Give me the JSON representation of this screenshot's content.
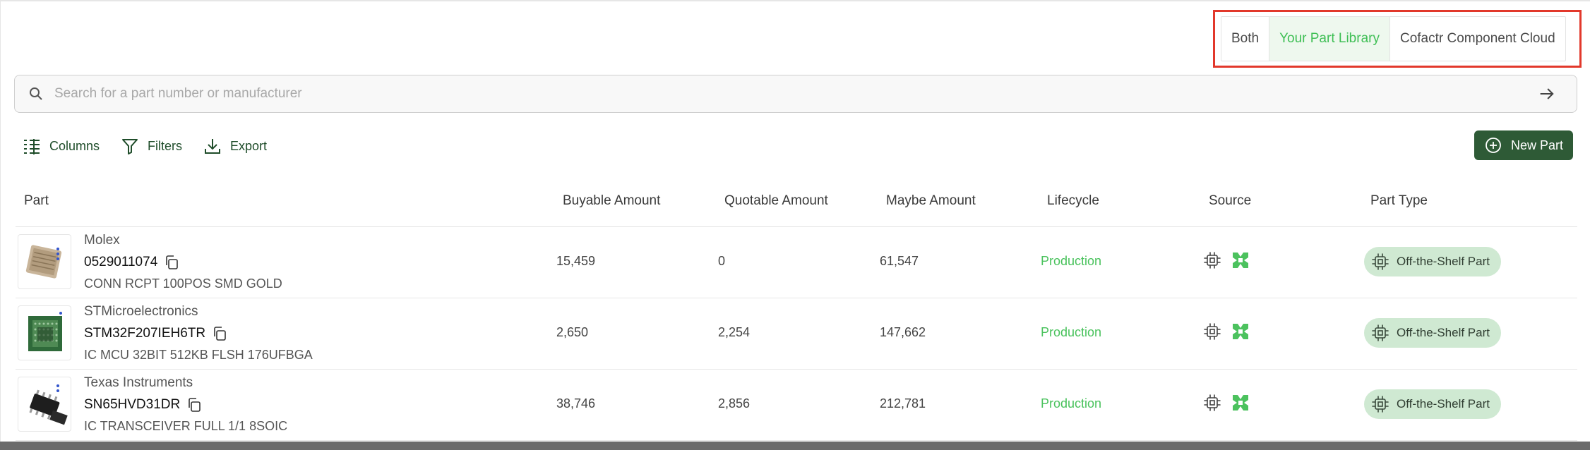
{
  "source_toggle": {
    "options": [
      {
        "label": "Both",
        "active": false
      },
      {
        "label": "Your Part Library",
        "active": true
      },
      {
        "label": "Cofactr Component Cloud",
        "active": false
      }
    ]
  },
  "search": {
    "placeholder": "Search for a part number or manufacturer",
    "value": ""
  },
  "toolbar": {
    "columns_label": "Columns",
    "filters_label": "Filters",
    "export_label": "Export",
    "new_part_label": "New Part"
  },
  "table": {
    "headers": [
      "Part",
      "Buyable Amount",
      "Quotable Amount",
      "Maybe Amount",
      "Lifecycle",
      "Source",
      "Part Type"
    ],
    "rows": [
      {
        "manufacturer": "Molex",
        "part_number": "0529011074",
        "description": "CONN RCPT 100POS SMD GOLD",
        "buyable": "15,459",
        "quotable": "0",
        "maybe": "61,547",
        "lifecycle": "Production",
        "part_type": "Off-the-Shelf Part",
        "thumb_icon": "connector-image"
      },
      {
        "manufacturer": "STMicroelectronics",
        "part_number": "STM32F207IEH6TR",
        "description": "IC MCU 32BIT 512KB FLSH 176UFBGA",
        "buyable": "2,650",
        "quotable": "2,254",
        "maybe": "147,662",
        "lifecycle": "Production",
        "part_type": "Off-the-Shelf Part",
        "thumb_icon": "bga-chip-image"
      },
      {
        "manufacturer": "Texas Instruments",
        "part_number": "SN65HVD31DR",
        "description": "IC TRANSCEIVER FULL 1/1 8SOIC",
        "buyable": "38,746",
        "quotable": "2,856",
        "maybe": "212,781",
        "lifecycle": "Production",
        "part_type": "Off-the-Shelf Part",
        "thumb_icon": "soic-chip-image"
      }
    ]
  },
  "colors": {
    "accent_green": "#49c25c",
    "primary_dark_green": "#2e5a36",
    "badge_bg": "#cfe9d2",
    "highlight_red": "#e2382b"
  }
}
